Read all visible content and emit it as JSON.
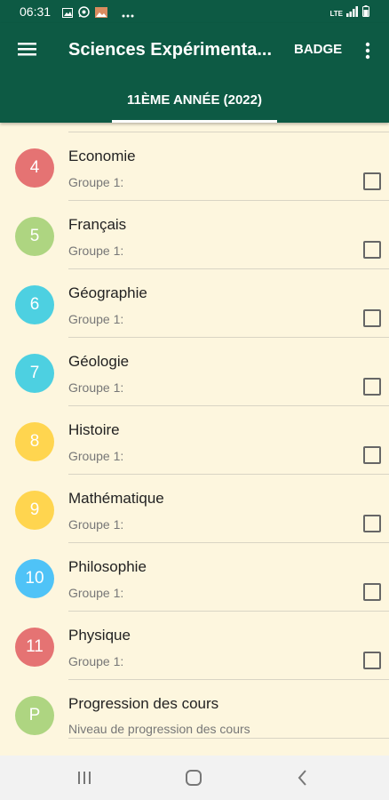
{
  "status_bar": {
    "time": "06:31",
    "notification_icons": [
      "gallery-icon",
      "whatsapp-icon",
      "photo-icon",
      "more-dots-icon"
    ],
    "right_icons": [
      "lte-icon",
      "signal-icon",
      "battery-icon"
    ],
    "network_label": "LTE"
  },
  "app_bar": {
    "title": "Sciences Expérimenta...",
    "badge_label": "BADGE",
    "tab_label": "11ÈME ANNÉE (2022)"
  },
  "list": {
    "items": [
      {
        "number": "4",
        "title": "Economie",
        "subtitle": "Groupe 1:",
        "color": "#e57373",
        "checked": false
      },
      {
        "number": "5",
        "title": "Français",
        "subtitle": "Groupe 1:",
        "color": "#aed581",
        "checked": false
      },
      {
        "number": "6",
        "title": "Géographie",
        "subtitle": "Groupe 1:",
        "color": "#4dd0e1",
        "checked": false
      },
      {
        "number": "7",
        "title": "Géologie",
        "subtitle": "Groupe 1:",
        "color": "#4dd0e1",
        "checked": false
      },
      {
        "number": "8",
        "title": "Histoire",
        "subtitle": "Groupe 1:",
        "color": "#ffd54f",
        "checked": false
      },
      {
        "number": "9",
        "title": "Mathématique",
        "subtitle": "Groupe 1:",
        "color": "#ffd54f",
        "checked": false
      },
      {
        "number": "10",
        "title": "Philosophie",
        "subtitle": "Groupe 1:",
        "color": "#4fc3f7",
        "checked": false
      },
      {
        "number": "11",
        "title": "Physique",
        "subtitle": "Groupe 1:",
        "color": "#e57373",
        "checked": false
      }
    ],
    "progress_item": {
      "letter": "P",
      "title": "Progression des cours",
      "subtitle": "Niveau de progression des cours",
      "color": "#aed581"
    }
  },
  "theme": {
    "primary": "#0d5a44",
    "background": "#fdf6de"
  }
}
